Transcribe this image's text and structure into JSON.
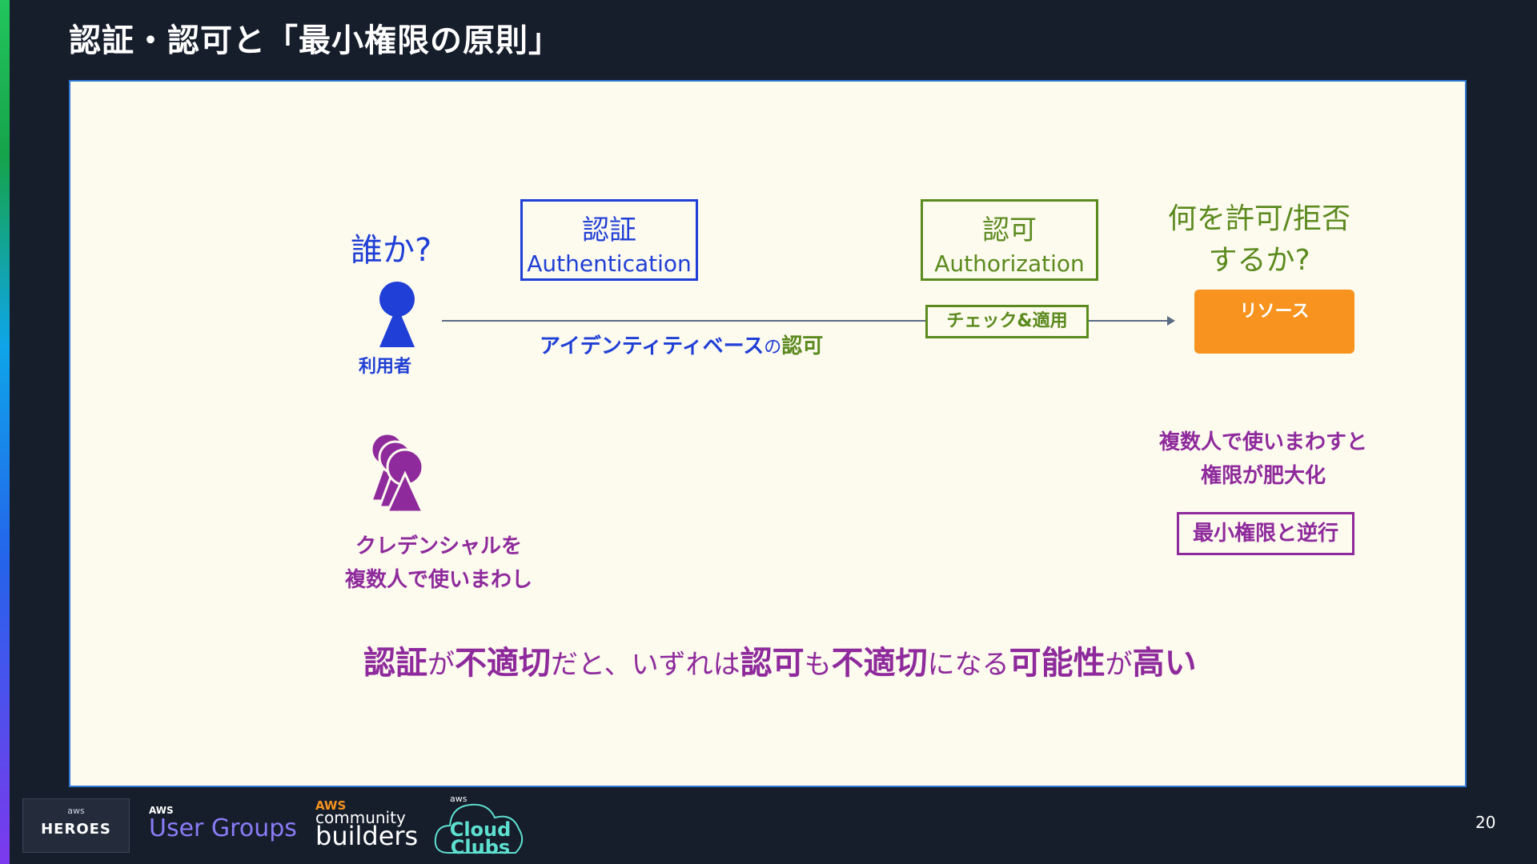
{
  "slide": {
    "title": "認証・認可と「最小権限の原則」",
    "page_number": "20"
  },
  "diagram": {
    "question_who": "誰か?",
    "authn": {
      "ja": "認証",
      "en": "Authentication"
    },
    "authz": {
      "ja": "認可",
      "en": "Authorization"
    },
    "question_what_line1": "何を許可/拒否",
    "question_what_line2": "するか?",
    "user_label": "利用者",
    "identity_caption_main": "アイデンティティベース",
    "identity_caption_no": "の",
    "identity_caption_authz": "認可",
    "check_label": "チェック&適用",
    "resource_label": "リソース",
    "shared_caption_line1": "クレデンシャルを",
    "shared_caption_line2": "複数人で使いまわし",
    "bloat_caption_line1": "複数人で使いまわすと",
    "bloat_caption_line2": "権限が肥大化",
    "least_privilege_box": "最小権限と逆行",
    "summary": {
      "p1": "認証",
      "p2": "が",
      "p3": "不適切",
      "p4": "だと、いずれは",
      "p5": "認可",
      "p6": "も",
      "p7": "不適切",
      "p8": "になる",
      "p9": "可能性",
      "p10": "が",
      "p11": "高い"
    },
    "colors": {
      "blue": "#1f3fd6",
      "green": "#5b8a1e",
      "purple": "#8e2a9c",
      "orange": "#f7931e"
    }
  },
  "footer": {
    "heroes_aws": "aws",
    "heroes": "HEROES",
    "user_groups_aws": "AWS",
    "user_groups": "User Groups",
    "community_aws": "AWS",
    "community": "community",
    "builders": "builders",
    "cloud_clubs_aws": "aws",
    "cloud": "Cloud",
    "clubs": "Clubs"
  }
}
